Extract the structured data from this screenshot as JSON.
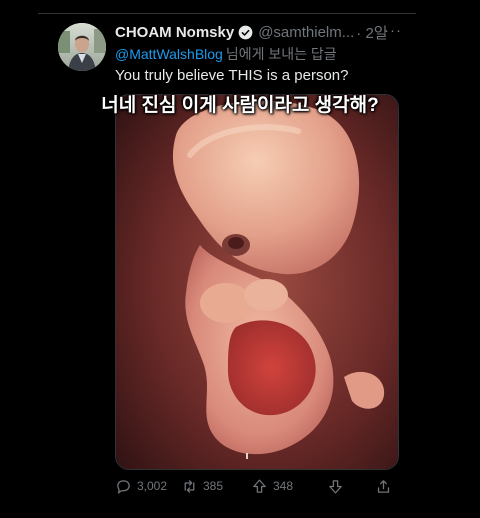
{
  "tweet": {
    "display_name": "CHOAM Nomsky",
    "handle": "@samthielm...",
    "time": "· 2일",
    "more_label": "···",
    "reply_mention": "@MattWalshBlog",
    "reply_suffix": "님에게 보내는 답글",
    "text": "You truly believe THIS is a person?"
  },
  "overlay_caption": "너네 진심 이게 사람이라고 생각해?",
  "actions": {
    "reply_count": "3,002",
    "retweet_count": "385",
    "like_count": "348"
  },
  "icons": {
    "verified": "verified-badge-icon",
    "reply": "reply-icon",
    "retweet": "retweet-icon",
    "like": "upvote-icon",
    "downvote": "downvote-icon",
    "share": "share-icon",
    "more": "more-icon"
  },
  "colors": {
    "background": "#000000",
    "text_primary": "#e7e9ea",
    "text_secondary": "#71767b",
    "link": "#1d9bf0",
    "divider": "#2f3336"
  }
}
